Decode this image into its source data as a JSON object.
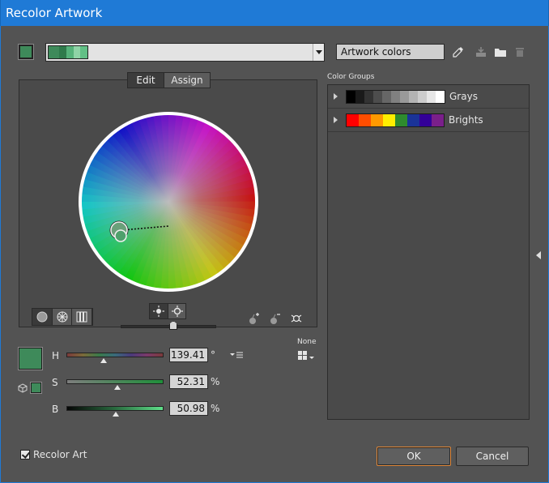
{
  "window": {
    "title": "Recolor Artwork"
  },
  "colors": {
    "active": "#3e8a5a",
    "strip": [
      "#3e8a5a",
      "#2f7a4b",
      "#56b27a",
      "#8fd3a6",
      "#62c086"
    ],
    "title_bar": "#1f7ad6",
    "ok_focus": "#e0883a"
  },
  "top_bar": {
    "artwork_field": "Artwork colors",
    "icons": [
      "eyedropper-icon",
      "save-group-icon",
      "folder-icon",
      "trash-icon"
    ]
  },
  "tabs": {
    "edit": "Edit",
    "assign": "Assign"
  },
  "wheel": {
    "mode_buttons": [
      "smooth-wheel-icon",
      "segmented-wheel-icon",
      "color-bars-icon"
    ],
    "brightness_toggle": [
      "show-brightness-icon",
      "show-saturation-icon"
    ],
    "right_icons": [
      "add-color-tool-icon",
      "remove-color-tool-icon",
      "link-harmony-colors-icon"
    ]
  },
  "hsb": {
    "h_label": "H",
    "s_label": "S",
    "b_label": "B",
    "h_value": "139.41",
    "s_value": "52.31",
    "b_value": "50.98",
    "h_unit": "°",
    "s_unit": "%",
    "b_unit": "%",
    "h_fraction": 0.387,
    "s_fraction": 0.523,
    "b_fraction": 0.51,
    "none_label": "None"
  },
  "color_groups": {
    "title": "Color Groups",
    "items": [
      {
        "name": "Grays",
        "swatches": [
          "#000000",
          "#1a1a1a",
          "#333333",
          "#4d4d4d",
          "#666666",
          "#808080",
          "#999999",
          "#b3b3b3",
          "#cccccc",
          "#e6e6e6",
          "#ffffff"
        ]
      },
      {
        "name": "Brights",
        "swatches": [
          "#ff0000",
          "#ff4d00",
          "#ff9900",
          "#ffee00",
          "#2e8b2e",
          "#1a3399",
          "#330099",
          "#7a1f8a"
        ]
      }
    ]
  },
  "footer": {
    "recolor_label": "Recolor Art",
    "ok": "OK",
    "cancel": "Cancel"
  }
}
